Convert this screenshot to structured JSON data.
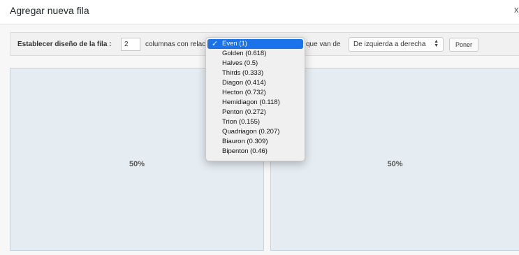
{
  "dialog": {
    "title": "Agregar nueva fila",
    "close_symbol": "x"
  },
  "toolbar": {
    "layout_label": "Establecer diseño de la fila :",
    "columns_value": "2",
    "ratio_label": "columnas con relación",
    "direction_label": "que van de",
    "direction_selected": "De izquierda a derecha",
    "set_button_label": "Poner"
  },
  "ratio_dropdown": {
    "options": [
      {
        "label": "Even (1)",
        "selected": true
      },
      {
        "label": "Golden (0.618)",
        "selected": false
      },
      {
        "label": "Halves (0.5)",
        "selected": false
      },
      {
        "label": "Thirds (0.333)",
        "selected": false
      },
      {
        "label": "Diagon (0.414)",
        "selected": false
      },
      {
        "label": "Hecton (0.732)",
        "selected": false
      },
      {
        "label": "Hemidiagon (0.118)",
        "selected": false
      },
      {
        "label": "Penton (0.272)",
        "selected": false
      },
      {
        "label": "Trion (0.155)",
        "selected": false
      },
      {
        "label": "Quadriagon (0.207)",
        "selected": false
      },
      {
        "label": "Biauron (0.309)",
        "selected": false
      },
      {
        "label": "Bipenton (0.46)",
        "selected": false
      }
    ]
  },
  "columns": [
    {
      "width_label": "50%"
    },
    {
      "width_label": "50%"
    }
  ],
  "colors": {
    "selected_highlight": "#1a73e8",
    "column_bg": "#e5edf3",
    "toolbar_bg": "#f1f1f1"
  },
  "icons": {
    "close": "close-icon",
    "check": "checkmark-icon",
    "select_arrows": "select-arrows-icon"
  }
}
